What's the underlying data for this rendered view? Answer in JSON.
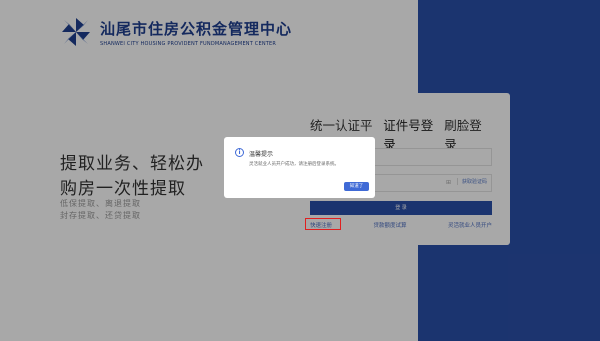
{
  "brand": {
    "name_cn": "汕尾市住房公积金管理中心",
    "name_en": "SHANWEI CITY HOUSING PROVIDENT FUNDMANAGEMENT CENTER"
  },
  "hero": {
    "line1": "提取业务、轻松办",
    "line2": "购房一次性提取",
    "sub1": "低保提取、离退提取",
    "sub2": "封存提取、还贷提取"
  },
  "login": {
    "tabs": [
      "统一认证平台",
      "证件号登录",
      "刷脸登录"
    ],
    "active_tab": 1,
    "get_code": "获取验证码",
    "login_button": "登 录",
    "links": [
      "快速注册",
      "贷款额度试算",
      "灵活就业人员开户"
    ]
  },
  "modal": {
    "icon": "info-icon",
    "title": "温馨提示",
    "message": "灵活就业人员开户成功，请注册后登录系统。",
    "ok_button": "知道了"
  },
  "colors": {
    "brand_blue": "#2a4fa9",
    "accent_blue": "#3f6ad6",
    "highlight_red": "#e02020"
  }
}
